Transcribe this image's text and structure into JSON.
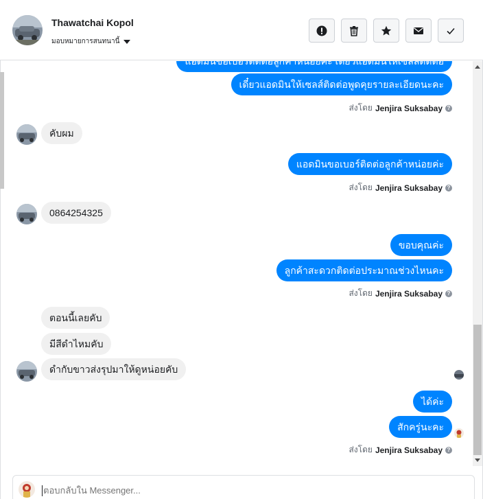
{
  "header": {
    "contact_name": "Thawatchai Kopol",
    "assign_label": "มอบหมายการสนทนานี้"
  },
  "actions": [
    {
      "name": "report-icon"
    },
    {
      "name": "trash-icon"
    },
    {
      "name": "star-icon"
    },
    {
      "name": "envelope-icon"
    },
    {
      "name": "check-icon"
    }
  ],
  "messages": {
    "m0": "แอดมินขอเบอร์ติดต่อลูกค้าหน่อยค่ะ เดี๋ยวแอดมินให้เซลล์ติดต่อ",
    "m1": "เดี๋ยวแอดมินให้เซลส์ติดต่อพูดคุยรายละเอียดนะคะ",
    "m2": "คับผม",
    "m3": "แอดมินขอเบอร์ติดต่อลูกค้าหน่อยค่ะ",
    "m4": "0864254325",
    "m5": "ขอบคุณค่ะ",
    "m6": "ลูกค้าสะดวกติดต่อประมาณช่วงไหนคะ",
    "m7": "ตอนนี้เลยคับ",
    "m8": "มีสีดำไหมคับ",
    "m9": "ดำกับขาวส่งรุปมาให้ดูหน่อยคับ",
    "m10": "ได้ค่ะ",
    "m11": "สักครู่นะคะ"
  },
  "sent_by": {
    "prefix": "ส่งโดย",
    "agent": "Jenjira Suksabay"
  },
  "composer": {
    "placeholder": "ตอบกลับใน Messenger..."
  },
  "colors": {
    "outgoing": "#0084ff",
    "incoming": "#f0f0f0"
  }
}
